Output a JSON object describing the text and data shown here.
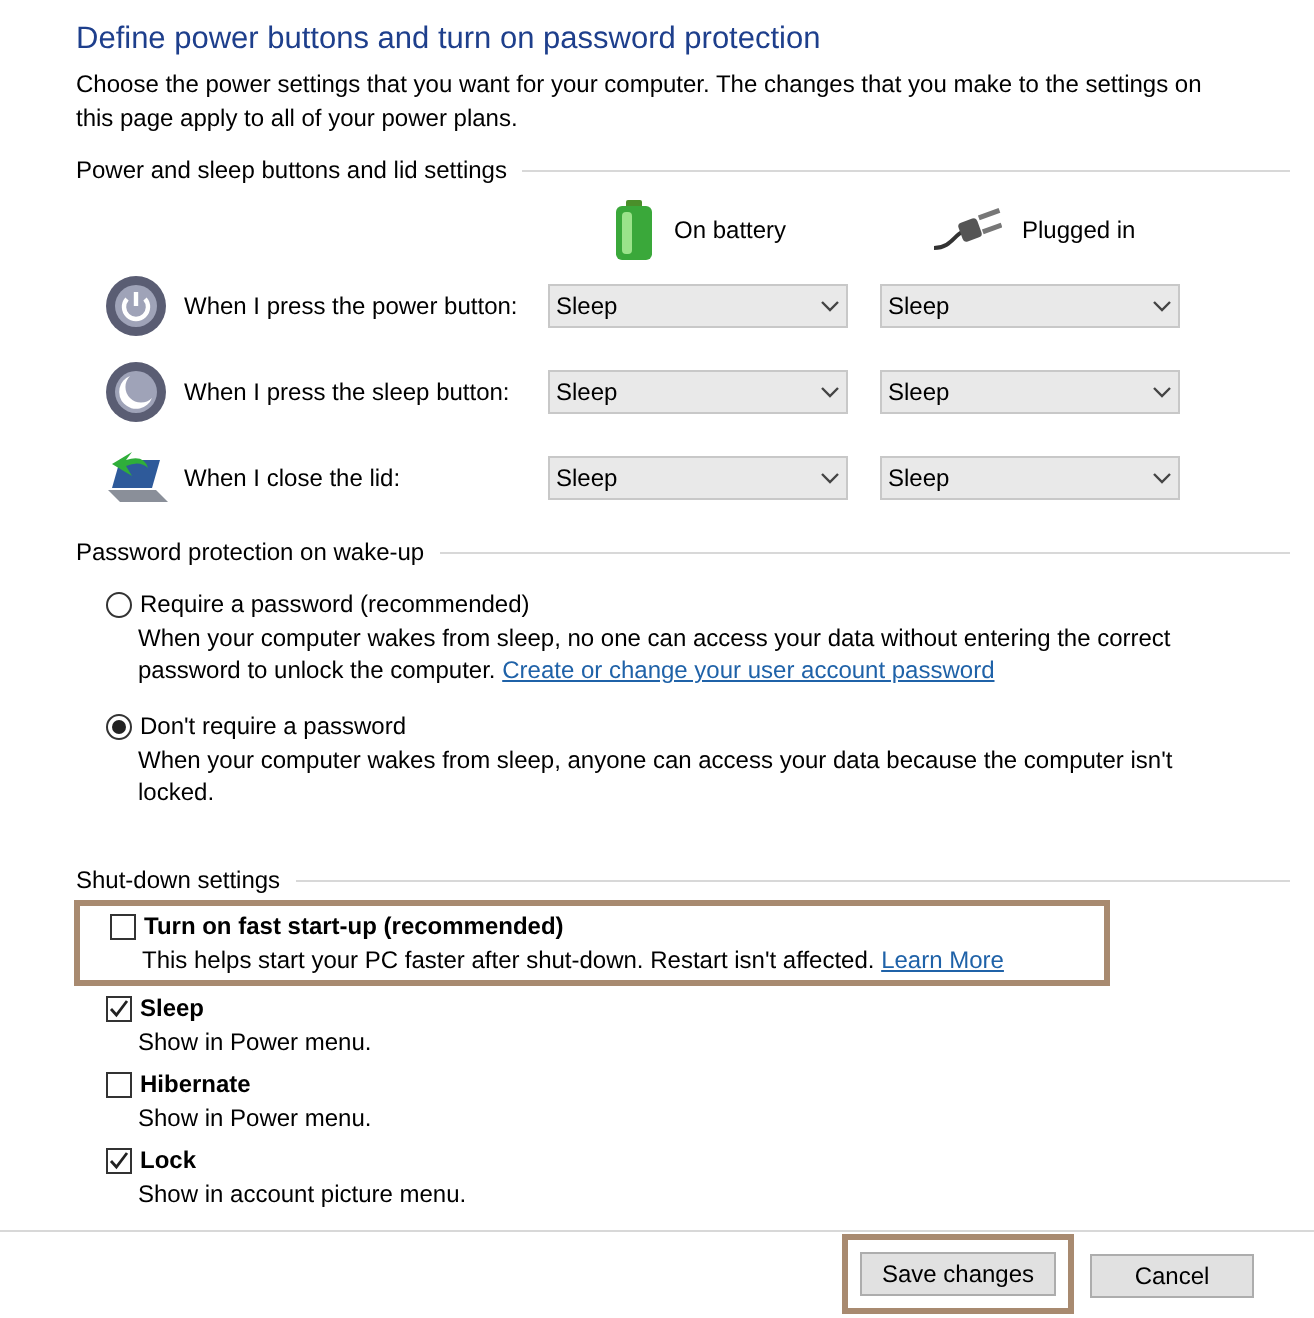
{
  "title": "Define power buttons and turn on password protection",
  "description": "Choose the power settings that you want for your computer. The changes that you make to the settings on this page apply to all of your power plans.",
  "buttons_section": {
    "heading": "Power and sleep buttons and lid settings",
    "columns": [
      {
        "kind": "battery",
        "label": "On battery"
      },
      {
        "kind": "plug",
        "label": "Plugged in"
      }
    ],
    "rows": [
      {
        "kind": "power",
        "label": "When I press the power button:",
        "on_battery": "Sleep",
        "plugged_in": "Sleep"
      },
      {
        "kind": "sleep",
        "label": "When I press the sleep button:",
        "on_battery": "Sleep",
        "plugged_in": "Sleep"
      },
      {
        "kind": "lid",
        "label": "When I close the lid:",
        "on_battery": "Sleep",
        "plugged_in": "Sleep"
      }
    ]
  },
  "password_section": {
    "heading": "Password protection on wake-up",
    "options": [
      {
        "label": "Require a password (recommended)",
        "selected": false,
        "description": "When your computer wakes from sleep, no one can access your data without entering the correct password to unlock the computer.",
        "link": "Create or change your user account password"
      },
      {
        "label": "Don't require a password",
        "selected": true,
        "description": "When your computer wakes from sleep, anyone can access your data because the computer isn't locked."
      }
    ]
  },
  "shutdown_section": {
    "heading": "Shut-down settings",
    "options": [
      {
        "label": "Turn on fast start-up (recommended)",
        "checked": false,
        "highlighted": true,
        "description": "This helps start your PC faster after shut-down. Restart isn't affected.",
        "link": "Learn More"
      },
      {
        "label": "Sleep",
        "checked": true,
        "highlighted": false,
        "description": "Show in Power menu."
      },
      {
        "label": "Hibernate",
        "checked": false,
        "highlighted": false,
        "description": "Show in Power menu."
      },
      {
        "label": "Lock",
        "checked": true,
        "highlighted": false,
        "description": "Show in account picture menu."
      }
    ]
  },
  "buttons": [
    {
      "label": "Save changes",
      "highlighted": true
    },
    {
      "label": "Cancel",
      "highlighted": false
    }
  ]
}
